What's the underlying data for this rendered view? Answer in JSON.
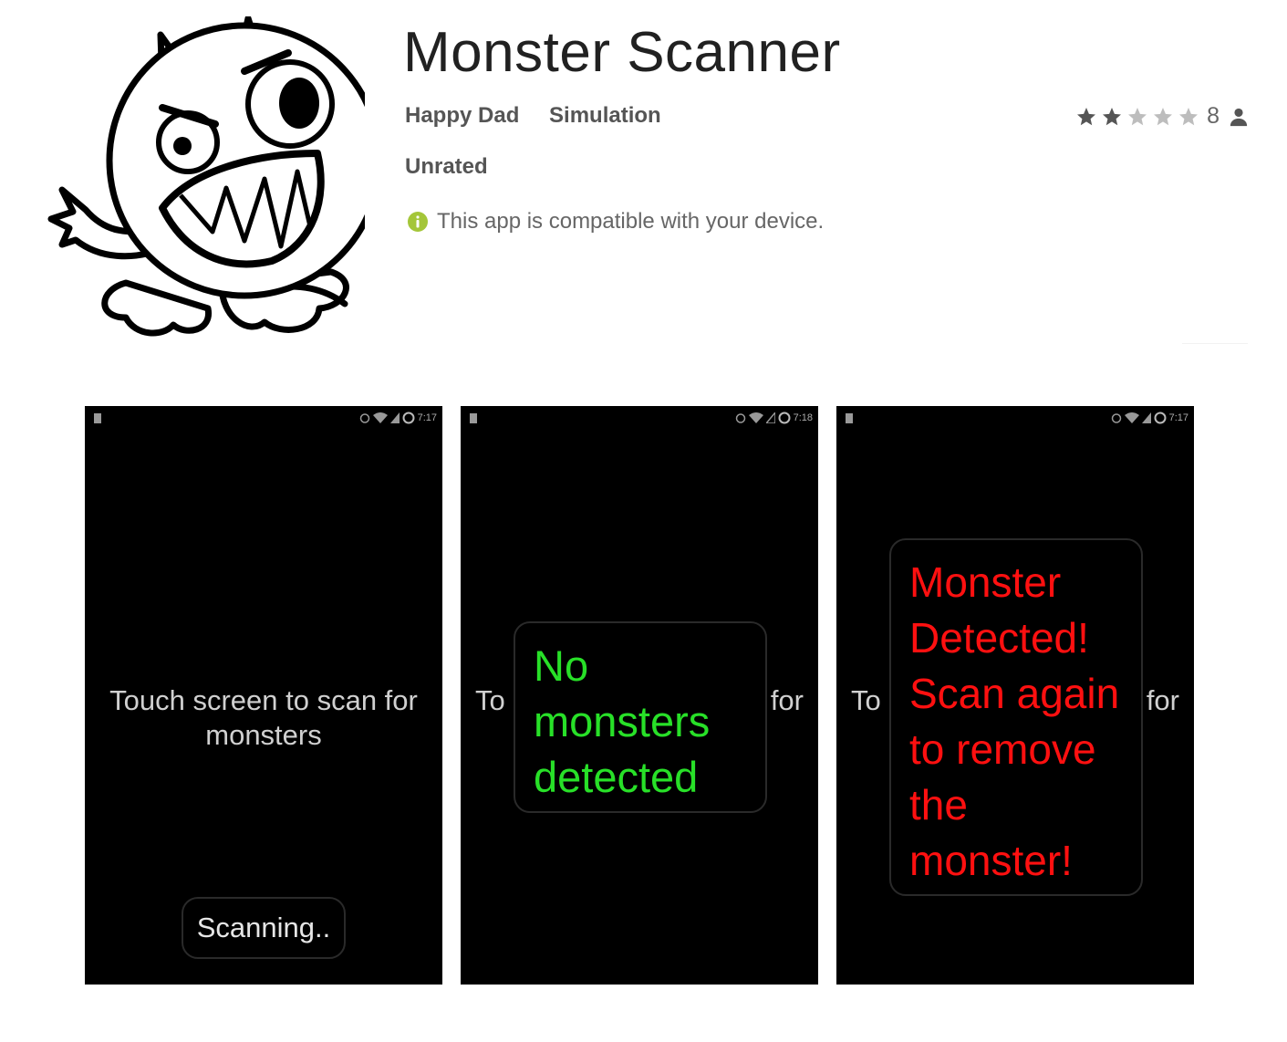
{
  "app": {
    "title": "Monster Scanner",
    "developer": "Happy Dad",
    "category": "Simulation",
    "content_rating": "Unrated",
    "compatibility_text": "This app is compatible with your device.",
    "icon": "monster-logo"
  },
  "rating": {
    "stars": 2,
    "max_stars": 5,
    "count": "8",
    "icon": "person-icon"
  },
  "colors": {
    "text_dark": "#212121",
    "text_meta": "#555555",
    "star_filled": "#555555",
    "star_empty": "#bdbdbd",
    "compat_badge": "#a4c639",
    "screenshot_bg": "#000000",
    "no_monster_green": "#28e028",
    "detected_red": "#ff1010"
  },
  "screenshots": [
    {
      "time": "7:17",
      "prompt_line1": "Touch screen to scan for",
      "prompt_line2": "monsters",
      "toast": "Scanning.."
    },
    {
      "time": "7:18",
      "prompt_left": "To",
      "prompt_right": "for",
      "toast_lines": [
        "No",
        "monsters",
        "detected"
      ]
    },
    {
      "time": "7:17",
      "prompt_left": "To",
      "prompt_right": "for",
      "toast_lines": [
        "Monster",
        "Detected!",
        "Scan again",
        "to remove",
        "the",
        "monster!"
      ]
    }
  ]
}
